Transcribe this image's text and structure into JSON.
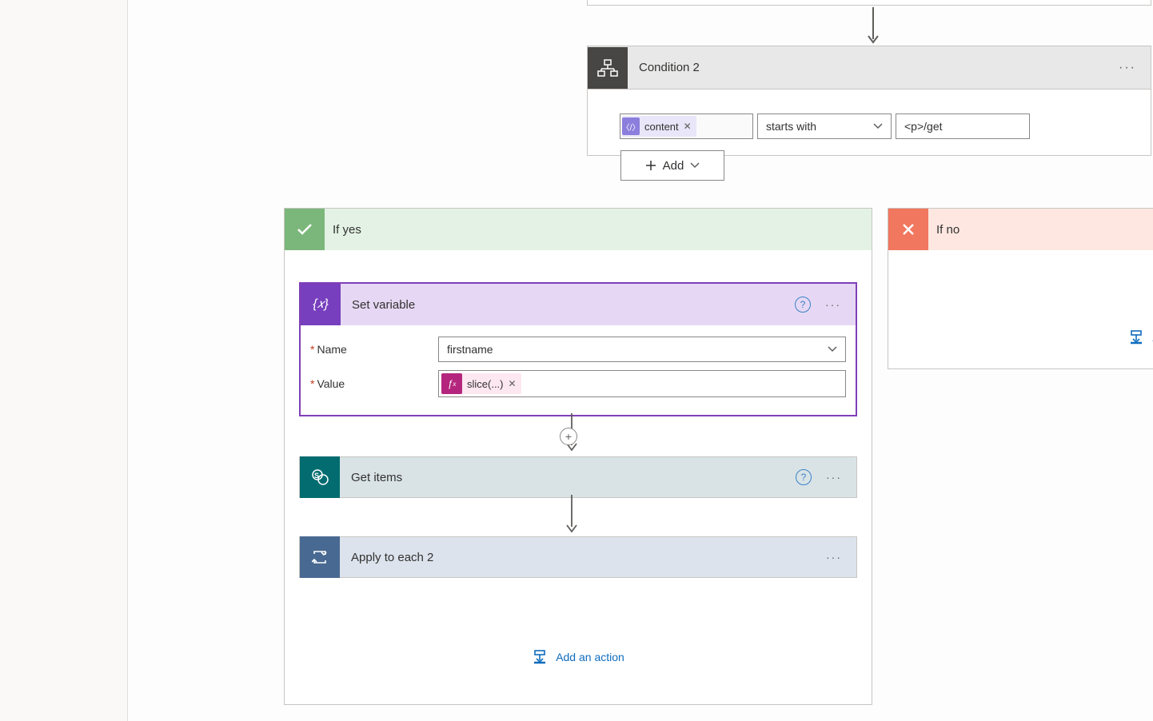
{
  "condition": {
    "title": "Condition 2",
    "left_token_label": "content",
    "operator": "starts with",
    "value": "<p>/get",
    "add_button": "Add"
  },
  "branches": {
    "yes": {
      "label": "If yes",
      "set_variable": {
        "title": "Set variable",
        "name_label": "Name",
        "name_value": "firstname",
        "value_label": "Value",
        "value_chip": "slice(...)"
      },
      "get_items_title": "Get items",
      "apply_each_title": "Apply to each 2",
      "add_action": "Add an action"
    },
    "no": {
      "label": "If no",
      "add_action": "Add an action"
    }
  }
}
